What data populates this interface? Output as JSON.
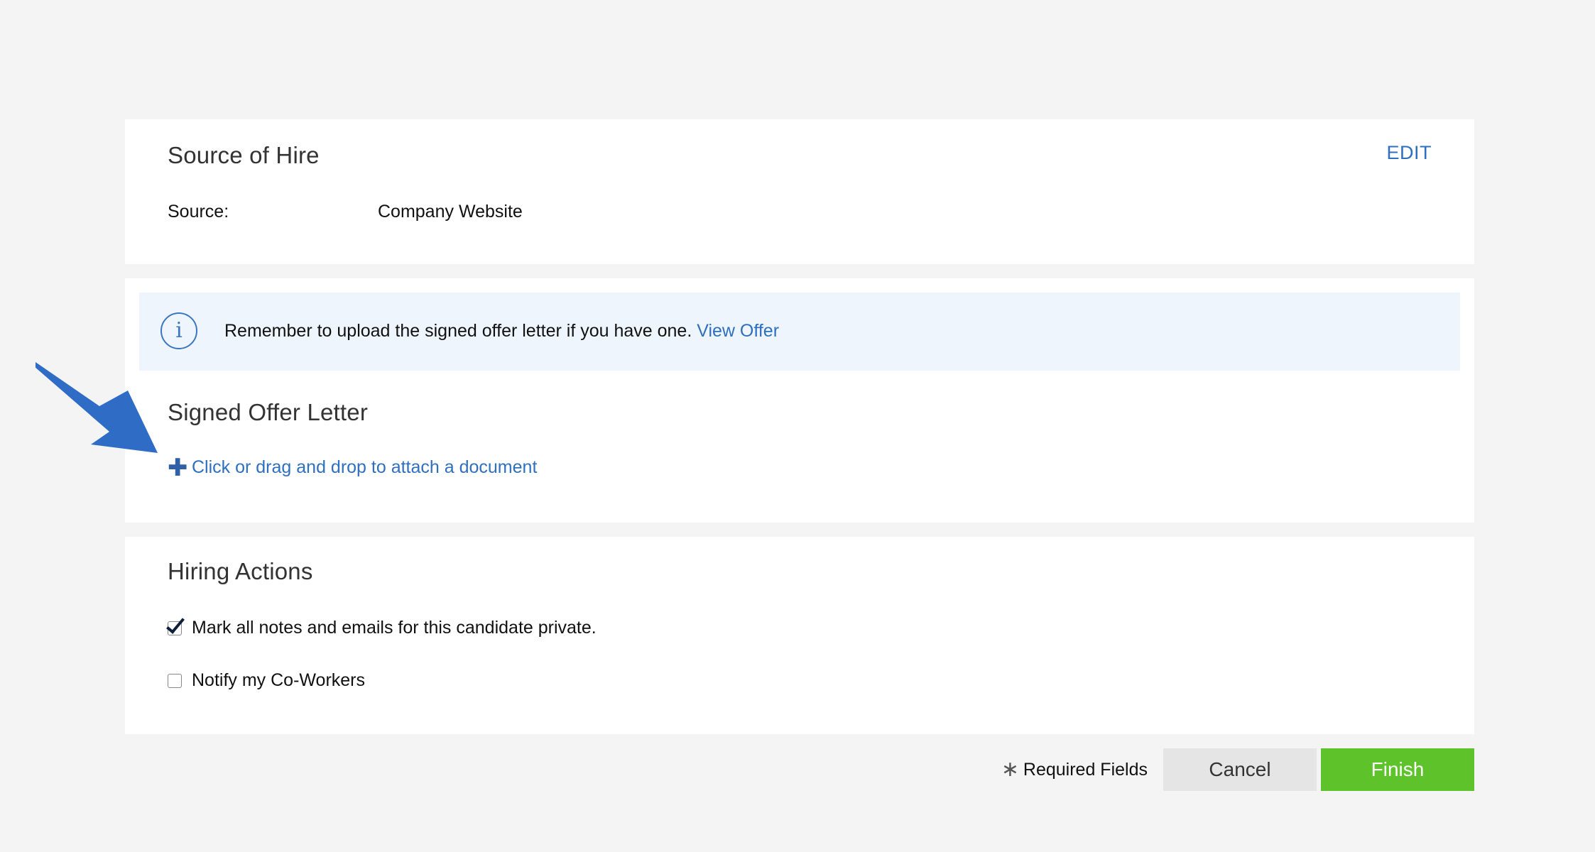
{
  "source_of_hire": {
    "title": "Source of Hire",
    "edit_label": "EDIT",
    "source_label": "Source:",
    "source_value": "Company Website"
  },
  "offer": {
    "banner_text": "Remember to upload the signed offer letter if you have one.",
    "banner_link": "View Offer",
    "info_icon_glyph": "i",
    "title": "Signed Offer Letter",
    "plus_glyph": "✚",
    "attach_text": "Click or drag and drop to attach a document"
  },
  "hiring_actions": {
    "title": "Hiring Actions",
    "options": [
      {
        "label": "Mark all notes and emails for this candidate private.",
        "checked": true
      },
      {
        "label": "Notify my Co-Workers",
        "checked": false
      }
    ]
  },
  "footer": {
    "required_star": "∗",
    "required_text": "Required Fields",
    "cancel_label": "Cancel",
    "finish_label": "Finish"
  },
  "colors": {
    "link": "#2f6fbf",
    "finish": "#5ec22b",
    "banner_bg": "#eef5fd",
    "annotation_arrow": "#2f6cc6"
  },
  "annotation": {
    "icon": "pointer-arrow-icon"
  }
}
